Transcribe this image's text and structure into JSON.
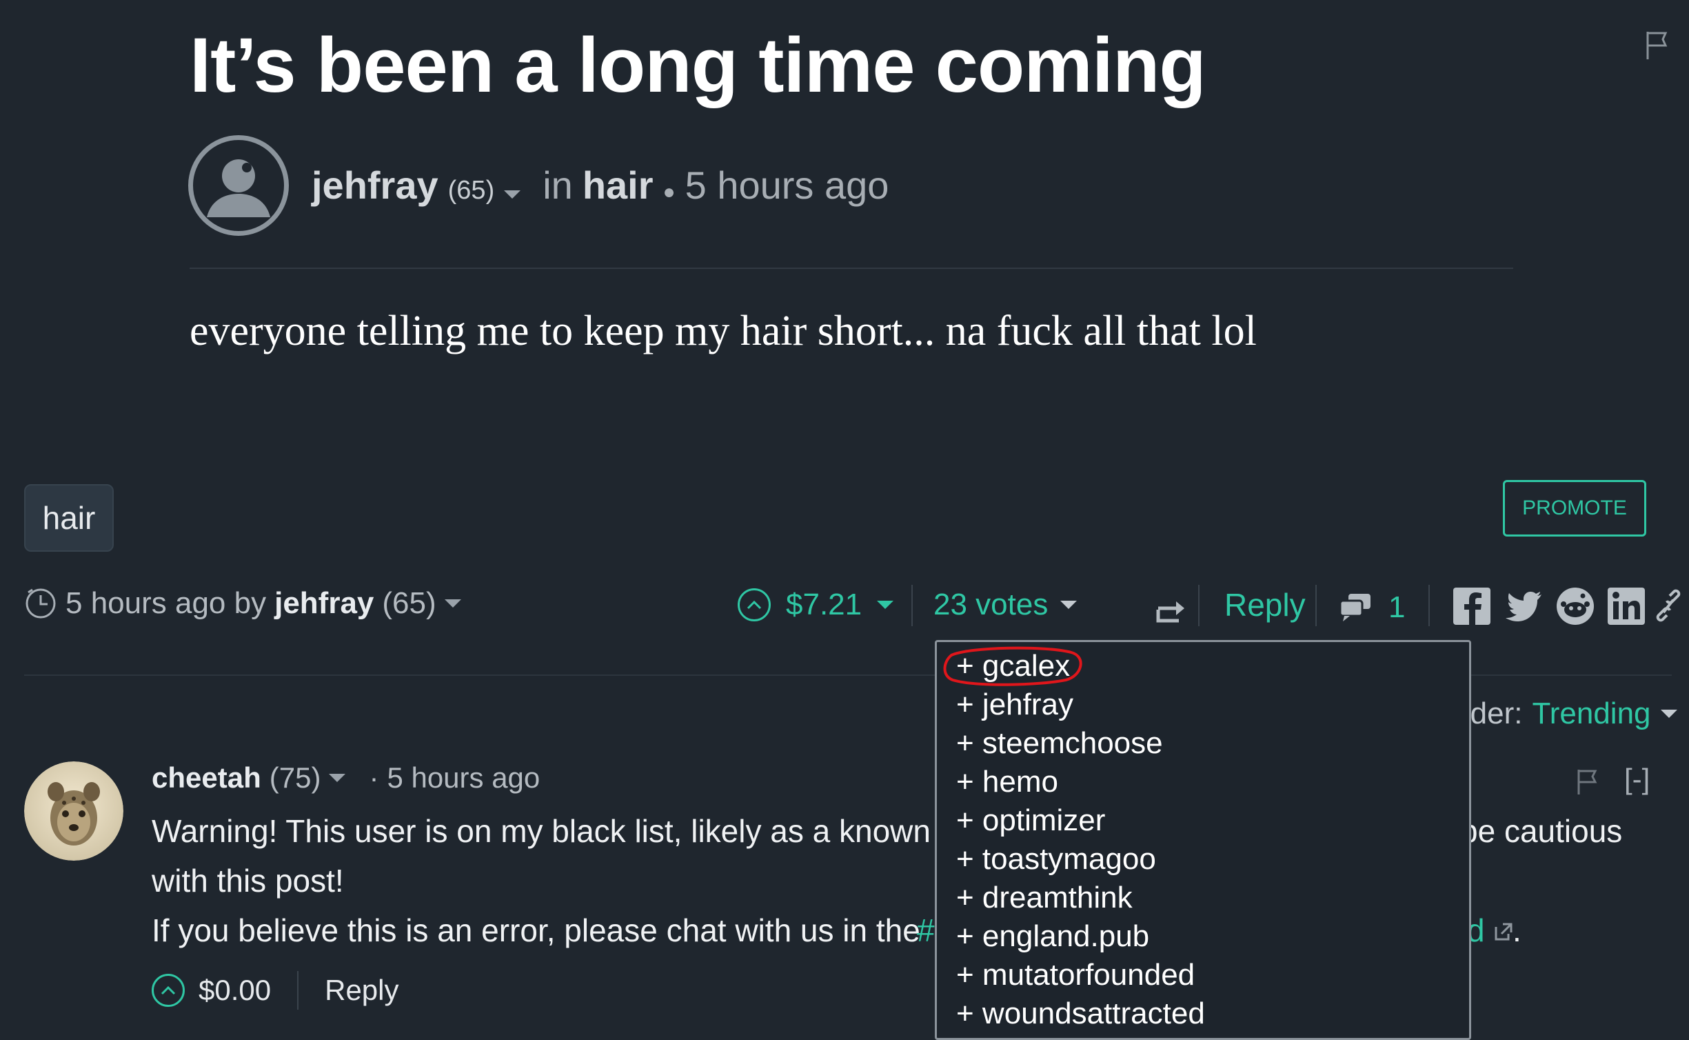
{
  "post": {
    "title": "It’s been a long time coming",
    "author": "jehfray",
    "reputation": "(65)",
    "in_label": "in",
    "community": "hair",
    "time_ago": "5 hours ago",
    "body": "everyone telling me to keep my hair short... na fuck all that lol",
    "tag": "hair"
  },
  "actions": {
    "promote_label": "PROMOTE",
    "footer_time": "5 hours ago by",
    "footer_author": "jehfray",
    "footer_rep": "(65)",
    "payout": "$7.21",
    "votes_label": "23 votes",
    "reply_label": "Reply",
    "comments_count": "1"
  },
  "sort": {
    "label": "rder:",
    "value": "Trending"
  },
  "voters": [
    "+ gcalex",
    "+ jehfray",
    "+ steemchoose",
    "+ hemo",
    "+ optimizer",
    "+ toastymagoo",
    "+ dreamthink",
    "+ england.pub",
    "+ mutatorfounded",
    "+ woundsattracted"
  ],
  "comment": {
    "author": "cheetah",
    "reputation": "(75)",
    "dot": "·",
    "time_ago": "5 hours ago",
    "collapse": "[-]",
    "line1_left": "Warning! This user is on my black list, likely as a known p",
    "line1_right": "be cautious",
    "line2": "with this post!",
    "line3_left": "If you believe this is an error, please chat with us in the ",
    "line3_hash": "#",
    "line3_right_link": "d",
    "line3_end": ".",
    "payout": "$0.00",
    "reply_label": "Reply"
  },
  "colors": {
    "background": "#1f262e",
    "accent": "#2fc7a4",
    "annotation": "#e0161b"
  },
  "icons": [
    "flag-icon",
    "user-avatar-icon",
    "clock-icon",
    "upvote-icon",
    "resteem-icon",
    "comments-icon",
    "facebook-icon",
    "twitter-icon",
    "reddit-icon",
    "linkedin-icon",
    "link-icon",
    "external-link-icon"
  ]
}
